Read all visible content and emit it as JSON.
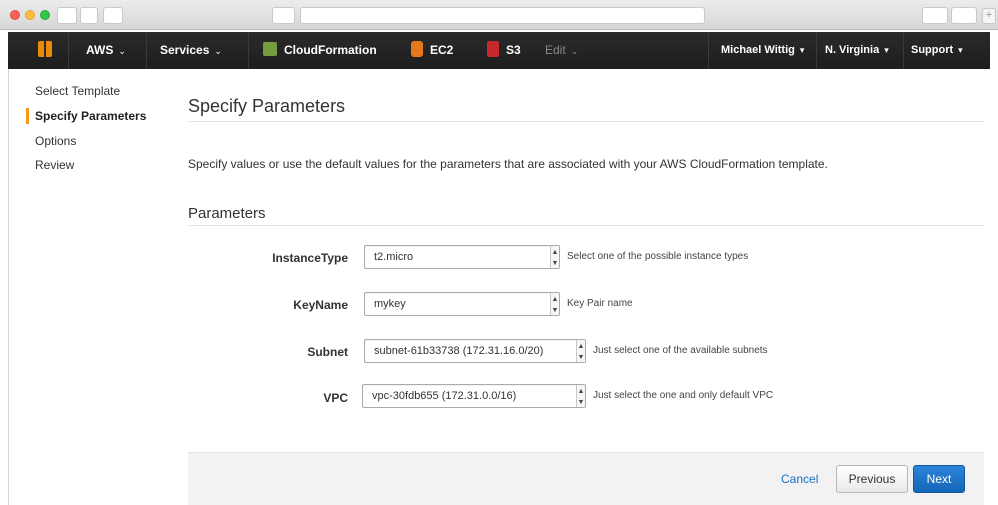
{
  "navbar": {
    "aws_label": "AWS",
    "services_label": "Services",
    "cloudformation_label": "CloudFormation",
    "ec2_label": "EC2",
    "s3_label": "S3",
    "edit_label": "Edit",
    "user_label": "Michael Wittig",
    "region_label": "N. Virginia",
    "support_label": "Support"
  },
  "sidebar": {
    "items": [
      {
        "label": "Select Template"
      },
      {
        "label": "Specify Parameters"
      },
      {
        "label": "Options"
      },
      {
        "label": "Review"
      }
    ]
  },
  "main": {
    "title": "Specify Parameters",
    "description": "Specify values or use the default values for the parameters that are associated with your AWS CloudFormation template.",
    "section_title": "Parameters",
    "params": [
      {
        "label": "InstanceType",
        "value": "t2.micro",
        "hint": "Select one of the possible instance types"
      },
      {
        "label": "KeyName",
        "value": "mykey",
        "hint": "Key Pair name"
      },
      {
        "label": "Subnet",
        "value": "subnet-61b33738 (172.31.16.0/20)",
        "hint": "Just select one of the available subnets"
      },
      {
        "label": "VPC",
        "value": "vpc-30fdb655 (172.31.0.0/16)",
        "hint": "Just select the one and only default VPC"
      }
    ]
  },
  "footer": {
    "cancel_label": "Cancel",
    "previous_label": "Previous",
    "next_label": "Next"
  },
  "colors": {
    "navbar": "#232f3e",
    "accent_orange": "#f29b1f",
    "primary_blue": "#1a6fc4"
  }
}
